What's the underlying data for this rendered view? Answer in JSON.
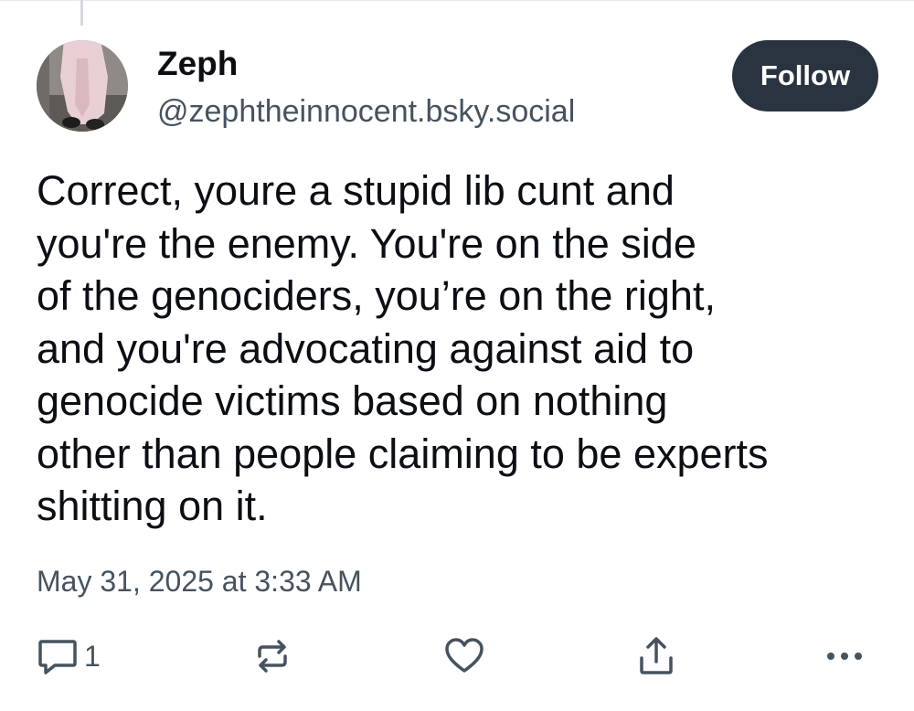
{
  "post": {
    "author": {
      "display_name": "Zeph",
      "handle": "@zephtheinnocent.bsky.social",
      "avatar_icon": "avatar-photo"
    },
    "follow_label": "Follow",
    "text": "Correct, youre a stupid lib cunt and\nyou're the enemy. You're on the side\nof the genociders, you’re on the right,\nand you're advocating against aid to\ngenocide victims based on nothing\nother than people claiming to be experts\nshitting on it.",
    "timestamp": "May 31, 2025 at 3:33 AM",
    "actions": {
      "reply_count": "1",
      "reply_icon": "reply-icon",
      "repost_icon": "repost-icon",
      "like_icon": "heart-icon",
      "share_icon": "share-icon",
      "more_icon": "more-options-icon"
    }
  },
  "colors": {
    "text": "#0b0f14",
    "secondary_text": "#46535f",
    "button_bg": "#2a3440",
    "button_text": "#ffffff",
    "icon": "#46535f"
  }
}
